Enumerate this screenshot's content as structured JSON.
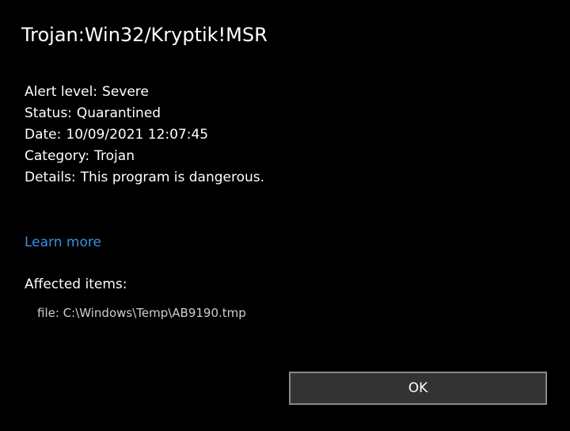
{
  "dialog": {
    "title": "Trojan:Win32/Kryptik!MSR",
    "details": [
      {
        "label": "Alert level:",
        "value": "Severe"
      },
      {
        "label": "Status:",
        "value": "Quarantined"
      },
      {
        "label": "Date:",
        "value": "10/09/2021 12:07:45"
      },
      {
        "label": "Category:",
        "value": "Trojan"
      },
      {
        "label": "Details:",
        "value": "This program is dangerous."
      }
    ],
    "learn_more": "Learn more",
    "affected_title": "Affected items:",
    "affected_items": [
      "file: C:\\Windows\\Temp\\AB9190.tmp"
    ],
    "ok_label": "OK"
  },
  "colors": {
    "background": "#000000",
    "text": "#ffffff",
    "link": "#3a8ee6",
    "button_bg": "#333333",
    "button_border": "#8a8a8a"
  }
}
